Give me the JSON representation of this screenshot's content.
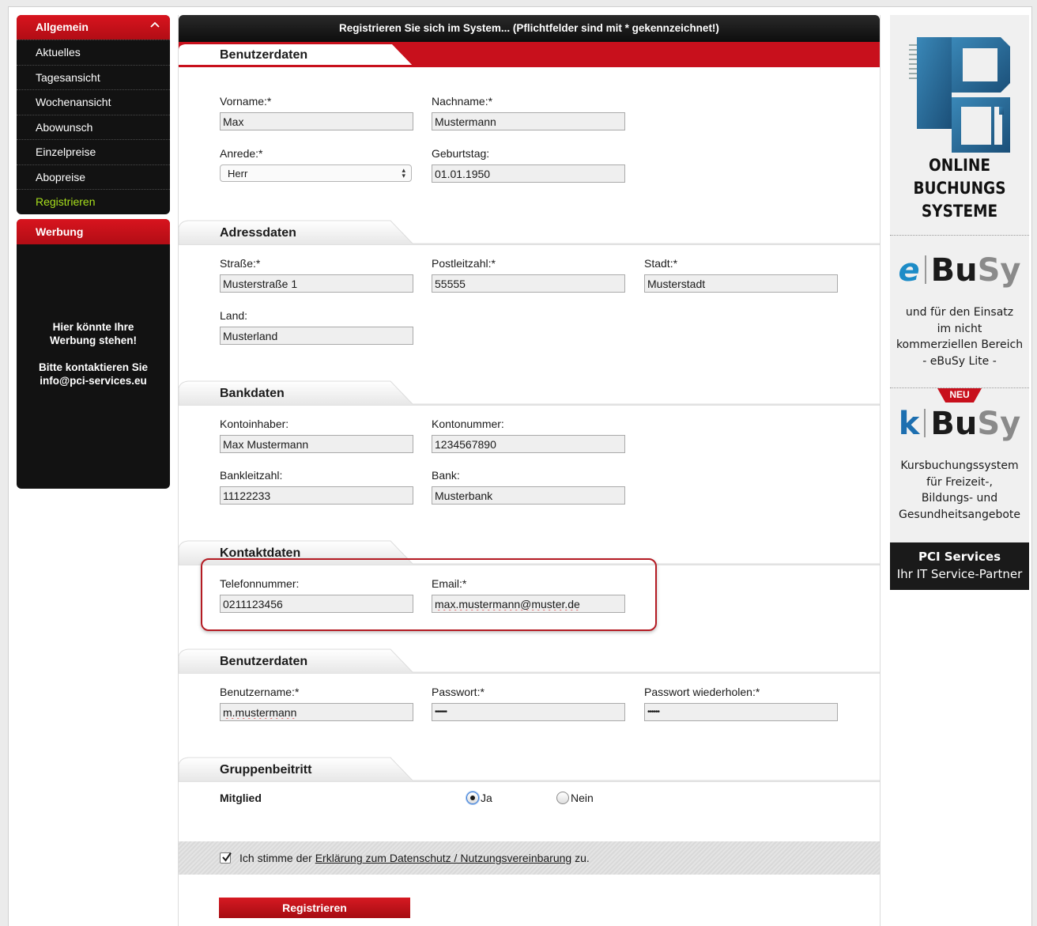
{
  "sidebar": {
    "menu_header": "Allgemein",
    "items": [
      {
        "label": "Aktuelles"
      },
      {
        "label": "Tagesansicht"
      },
      {
        "label": "Wochenansicht"
      },
      {
        "label": "Abowunsch"
      },
      {
        "label": "Einzelpreise"
      },
      {
        "label": "Abopreise"
      },
      {
        "label": "Registrieren"
      }
    ],
    "active_item": "Registrieren",
    "ad_header": "Werbung",
    "ad_line1": "Hier könnte Ihre",
    "ad_line2": "Werbung stehen!",
    "ad_line3": "Bitte kontaktieren Sie",
    "ad_line4": "info@pci-services.eu"
  },
  "form": {
    "title": "Registrieren Sie sich im System... (Pflichtfelder sind mit * gekennzeichnet!)",
    "user_section": {
      "title": "Benutzerdaten",
      "vorname_label": "Vorname:*",
      "vorname_value": "Max",
      "nachname_label": "Nachname:*",
      "nachname_value": "Mustermann",
      "anrede_label": "Anrede:*",
      "anrede_value": "Herr",
      "geburtstag_label": "Geburtstag:",
      "geburtstag_value": "01.01.1950"
    },
    "address_section": {
      "title": "Adressdaten",
      "strasse_label": "Straße:*",
      "strasse_value": "Musterstraße 1",
      "plz_label": "Postleitzahl:*",
      "plz_value": "55555",
      "stadt_label": "Stadt:*",
      "stadt_value": "Musterstadt",
      "land_label": "Land:",
      "land_value": "Musterland"
    },
    "bank_section": {
      "title": "Bankdaten",
      "inhaber_label": "Kontoinhaber:",
      "inhaber_value": "Max Mustermann",
      "kontonr_label": "Kontonummer:",
      "kontonr_value": "1234567890",
      "blz_label": "Bankleitzahl:",
      "blz_value": "11122233",
      "bank_label": "Bank:",
      "bank_value": "Musterbank"
    },
    "contact_section": {
      "title": "Kontaktdaten",
      "telefon_label": "Telefonnummer:",
      "telefon_value": "0211123456",
      "email_label": "Email:*",
      "email_value": "max.mustermann@muster.de"
    },
    "login_section": {
      "title": "Benutzerdaten",
      "username_label": "Benutzername:*",
      "username_value": "m.mustermann",
      "passwort_label": "Passwort:*",
      "passwort_value": "••••••",
      "passwort2_label": "Passwort wiederholen:*",
      "passwort2_value": "••••••"
    },
    "group_section": {
      "title": "Gruppenbeitritt",
      "member_label": "Mitglied",
      "option_yes": "Ja",
      "option_no": "Nein",
      "selected": "Ja"
    },
    "consent": {
      "prefix": "Ich stimme der ",
      "link": "Erklärung zum Datenschutz / Nutzungsvereinbarung",
      "suffix": " zu.",
      "checked": true
    },
    "submit_label": "Registrieren"
  },
  "banner": {
    "title_line1": "ONLINE",
    "title_line2": "BUCHUNGS",
    "title_line3": "SYSTEME",
    "ebusy_prefix": "e",
    "ebusy_bu": "Bu",
    "ebusy_sy": "Sy",
    "ebusy_line1": "und für den Einsatz",
    "ebusy_line2": "im nicht",
    "ebusy_line3": "kommerziellen Bereich",
    "ebusy_line4": "- eBuSy Lite -",
    "neu_badge": "NEU",
    "kbusy_prefix": "k",
    "kbusy_bu": "Bu",
    "kbusy_sy": "Sy",
    "kbusy_line1": "Kursbuchungssystem",
    "kbusy_line2": "für Freizeit-,",
    "kbusy_line3": "Bildungs- und",
    "kbusy_line4": "Gesundheitsangebote",
    "footer_line1": "PCI Services",
    "footer_line2": "Ihr IT Service-Partner"
  },
  "colors": {
    "accent_red": "#c8101c",
    "sidebar_bg": "#121212",
    "active_green": "#a8e01c",
    "brand_blue": "#1d8cc7"
  }
}
